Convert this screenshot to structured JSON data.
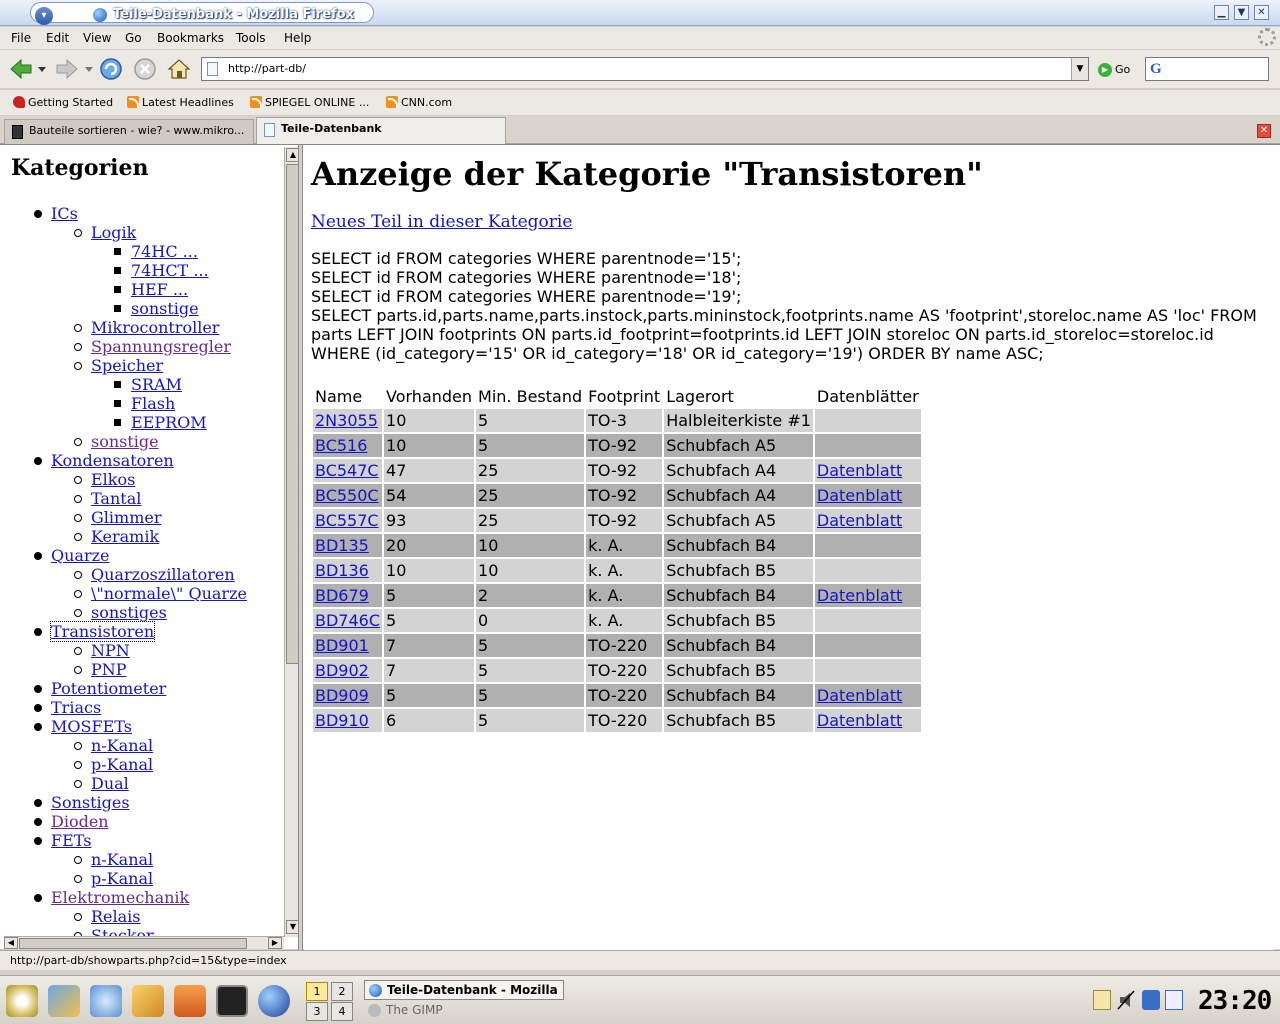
{
  "window": {
    "title": "Teile-Datenbank - Mozilla Firefox"
  },
  "menu": [
    "File",
    "Edit",
    "View",
    "Go",
    "Bookmarks",
    "Tools",
    "Help"
  ],
  "navbar": {
    "url": "http://part-db/",
    "go_label": "Go"
  },
  "bookmarks": [
    "Getting Started",
    "Latest Headlines",
    "SPIEGEL ONLINE ...",
    "CNN.com"
  ],
  "tabs": [
    {
      "label": "Bauteile sortieren - wie? - www.mikro...",
      "active": false
    },
    {
      "label": "Teile-Datenbank",
      "active": true
    }
  ],
  "sidebar": {
    "heading": "Kategorien",
    "tree": [
      {
        "label": "ICs",
        "level": 0
      },
      {
        "label": "Logik",
        "level": 1
      },
      {
        "label": "74HC ...",
        "level": 2
      },
      {
        "label": "74HCT ...",
        "level": 2
      },
      {
        "label": "HEF ...",
        "level": 2
      },
      {
        "label": "sonstige",
        "level": 2
      },
      {
        "label": "Mikrocontroller",
        "level": 1
      },
      {
        "label": "Spannungsregler",
        "level": 1,
        "visited": true
      },
      {
        "label": "Speicher",
        "level": 1
      },
      {
        "label": "SRAM",
        "level": 2
      },
      {
        "label": "Flash",
        "level": 2
      },
      {
        "label": "EEPROM",
        "level": 2
      },
      {
        "label": "sonstige",
        "level": 1,
        "visited": true
      },
      {
        "label": "Kondensatoren",
        "level": 0
      },
      {
        "label": "Elkos",
        "level": 1
      },
      {
        "label": "Tantal",
        "level": 1
      },
      {
        "label": "Glimmer",
        "level": 1
      },
      {
        "label": "Keramik",
        "level": 1
      },
      {
        "label": "Quarze",
        "level": 0
      },
      {
        "label": "Quarzoszillatoren",
        "level": 1
      },
      {
        "label": "\\\"normale\\\" Quarze",
        "level": 1
      },
      {
        "label": "sonstiges",
        "level": 1
      },
      {
        "label": "Transistoren",
        "level": 0,
        "focused": true
      },
      {
        "label": "NPN",
        "level": 1
      },
      {
        "label": "PNP",
        "level": 1
      },
      {
        "label": "Potentiometer",
        "level": 0
      },
      {
        "label": "Triacs",
        "level": 0
      },
      {
        "label": "MOSFETs",
        "level": 0
      },
      {
        "label": "n-Kanal",
        "level": 1
      },
      {
        "label": "p-Kanal",
        "level": 1
      },
      {
        "label": "Dual",
        "level": 1
      },
      {
        "label": "Sonstiges",
        "level": 0
      },
      {
        "label": "Dioden",
        "level": 0,
        "visited": true
      },
      {
        "label": "FETs",
        "level": 0
      },
      {
        "label": "n-Kanal",
        "level": 1
      },
      {
        "label": "p-Kanal",
        "level": 1
      },
      {
        "label": "Elektromechanik",
        "level": 0,
        "visited": true
      },
      {
        "label": "Relais",
        "level": 1
      },
      {
        "label": "Stecker",
        "level": 1
      }
    ]
  },
  "main": {
    "title": "Anzeige der Kategorie \"Transistoren\"",
    "new_part_link": "Neues Teil in dieser Kategorie",
    "sql_lines": [
      "SELECT id FROM categories WHERE parentnode='15';",
      "SELECT id FROM categories WHERE parentnode='18';",
      "SELECT id FROM categories WHERE parentnode='19';",
      "SELECT parts.id,parts.name,parts.instock,parts.mininstock,footprints.name AS 'footprint',storeloc.name AS 'loc' FROM parts LEFT JOIN footprints ON parts.id_footprint=footprints.id LEFT JOIN storeloc ON parts.id_storeloc=storeloc.id WHERE (id_category='15' OR id_category='18' OR id_category='19') ORDER BY name ASC;"
    ],
    "table": {
      "headers": [
        "Name",
        "Vorhanden",
        "Min. Bestand",
        "Footprint",
        "Lagerort",
        "Datenblätter"
      ],
      "rows": [
        [
          "2N3055",
          "10",
          "5",
          "TO-3",
          "Halbleiterkiste #1",
          ""
        ],
        [
          "BC516",
          "10",
          "5",
          "TO-92",
          "Schubfach A5",
          ""
        ],
        [
          "BC547C",
          "47",
          "25",
          "TO-92",
          "Schubfach A4",
          "Datenblatt"
        ],
        [
          "BC550C",
          "54",
          "25",
          "TO-92",
          "Schubfach A4",
          "Datenblatt"
        ],
        [
          "BC557C",
          "93",
          "25",
          "TO-92",
          "Schubfach A5",
          "Datenblatt"
        ],
        [
          "BD135",
          "20",
          "10",
          "k. A.",
          "Schubfach B4",
          ""
        ],
        [
          "BD136",
          "10",
          "10",
          "k. A.",
          "Schubfach B5",
          ""
        ],
        [
          "BD679",
          "5",
          "2",
          "k. A.",
          "Schubfach B4",
          "Datenblatt"
        ],
        [
          "BD746C",
          "5",
          "0",
          "k. A.",
          "Schubfach B5",
          ""
        ],
        [
          "BD901",
          "7",
          "5",
          "TO-220",
          "Schubfach B4",
          ""
        ],
        [
          "BD902",
          "7",
          "5",
          "TO-220",
          "Schubfach B5",
          ""
        ],
        [
          "BD909",
          "5",
          "5",
          "TO-220",
          "Schubfach B4",
          "Datenblatt"
        ],
        [
          "BD910",
          "6",
          "5",
          "TO-220",
          "Schubfach B5",
          "Datenblatt"
        ]
      ]
    }
  },
  "statusbar": {
    "text": "http://part-db/showparts.php?cid=15&type=index"
  },
  "taskbar": {
    "desktops": [
      "1",
      "2",
      "3",
      "4"
    ],
    "tasks": [
      "Teile-Datenbank - Mozilla F",
      "The GIMP"
    ],
    "clock": "23:20"
  },
  "colors": {
    "link": "#1515c8",
    "visited_link": "#6b2a8a",
    "row_light": "#d3d3d3",
    "row_dark": "#b0b0b0"
  }
}
